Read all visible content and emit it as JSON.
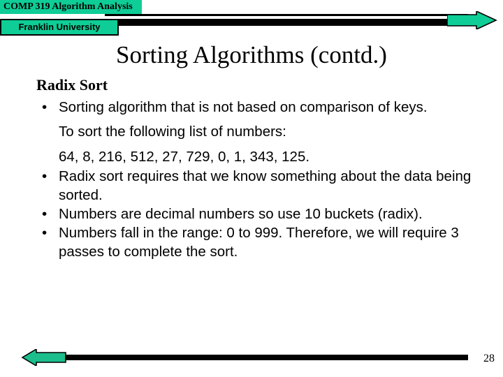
{
  "header": {
    "course_tag": "COMP 319 Algorithm Analysis",
    "university_tag": "Franklin University",
    "accent_color": "#0ECD96",
    "rule_color": "#000000",
    "forward_arrow_icon": "arrow-right-icon"
  },
  "slide": {
    "title": "Sorting Algorithms (contd.)",
    "subhead": "Radix Sort",
    "bullets": [
      "Sorting algorithm that is not based on comparison of keys.",
      "Radix sort requires that we know something about the data being sorted.",
      "Numbers are decimal numbers so use 10  buckets (radix).",
      "Numbers fall in the range: 0 to 999. Therefore, we will require 3 passes to complete the sort."
    ],
    "sublines": [
      "To sort the following list of numbers:",
      "64, 8, 216, 512, 27, 729, 0, 1, 343, 125."
    ],
    "bullet_glyph": "•"
  },
  "footer": {
    "back_arrow_icon": "arrow-left-icon",
    "page_number": "28"
  }
}
